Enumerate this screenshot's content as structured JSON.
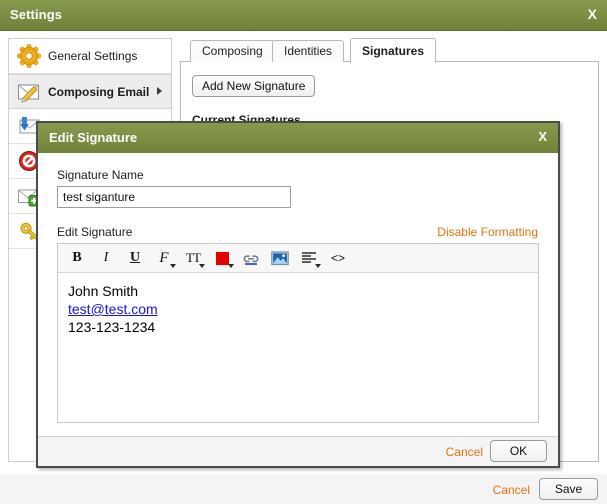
{
  "window": {
    "title": "Settings",
    "close_label": "X"
  },
  "sidebar": {
    "items": [
      {
        "label": "General Settings",
        "icon": "gear-icon",
        "selected": false
      },
      {
        "label": "Composing Email",
        "icon": "envelope-pencil-icon",
        "selected": true
      },
      {
        "label": "",
        "icon": "envelope-download-icon",
        "selected": false
      },
      {
        "label": "",
        "icon": "blocked-icon",
        "selected": false
      },
      {
        "label": "",
        "icon": "envelope-add-icon",
        "selected": false
      },
      {
        "label": "",
        "icon": "key-icon",
        "selected": false
      }
    ]
  },
  "main": {
    "tabs": [
      {
        "label": "Composing",
        "active": false
      },
      {
        "label": "Identities",
        "active": false
      },
      {
        "label": "Signatures",
        "active": true
      }
    ],
    "add_new_signature_label": "Add New Signature",
    "current_signatures_heading": "Current Signatures"
  },
  "bottom_bar": {
    "cancel_label": "Cancel",
    "save_label": "Save"
  },
  "modal": {
    "title": "Edit Signature",
    "close_label": "X",
    "signature_name_label": "Signature Name",
    "signature_name_value": "test siganture",
    "signature_name_placeholder": "",
    "edit_signature_label": "Edit Signature",
    "disable_formatting_label": "Disable Formatting",
    "toolbar": [
      {
        "name": "bold-icon",
        "glyph": "B",
        "caret": false
      },
      {
        "name": "italic-icon",
        "glyph": "I",
        "caret": false
      },
      {
        "name": "underline-icon",
        "glyph": "U",
        "caret": false
      },
      {
        "name": "font-family-icon",
        "glyph": "F",
        "caret": true
      },
      {
        "name": "font-size-icon",
        "glyph": "TT",
        "caret": true
      },
      {
        "name": "text-color-icon",
        "glyph": "",
        "caret": true
      },
      {
        "name": "insert-link-icon",
        "glyph": "",
        "caret": false
      },
      {
        "name": "insert-image-icon",
        "glyph": "",
        "caret": false
      },
      {
        "name": "align-icon",
        "glyph": "",
        "caret": true
      },
      {
        "name": "source-code-icon",
        "glyph": "<>",
        "caret": false
      }
    ],
    "editor_content": {
      "name": "John Smith",
      "email": "test@test.com",
      "phone": "123-123-1234"
    },
    "cancel_label": "Cancel",
    "ok_label": "OK"
  },
  "colors": {
    "titlebar_green": "#7d9046",
    "accent_orange": "#e8730e",
    "link_blue": "#1414dd",
    "text_color_swatch": "#e60000"
  }
}
